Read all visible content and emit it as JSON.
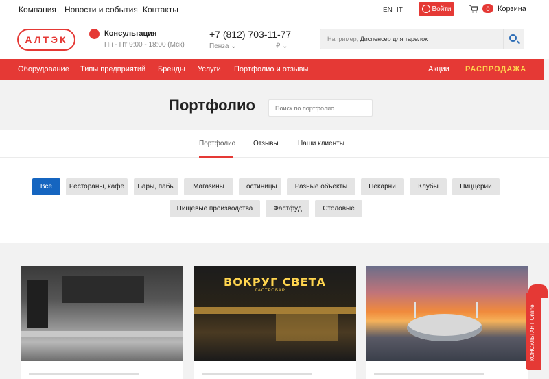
{
  "topbar": {
    "nav": [
      "Компания",
      "Новости и события",
      "Контакты"
    ],
    "langs": [
      "EN",
      "IT"
    ],
    "login": "Войти",
    "cart_count": "0",
    "cart_label": "Корзина"
  },
  "header": {
    "logo": "АЛТЭК",
    "consult_title": "Консультация",
    "consult_hours": "Пн - Пт 9:00 - 18:00 (Мск)",
    "phone": "+7 (812) 703-11-77",
    "city": "Пенза",
    "currency": "₽",
    "search_prefix": "Например,",
    "search_example": "Диспенсер для тарелок"
  },
  "rednav": {
    "items": [
      "Оборудование",
      "Типы предприятий",
      "Бренды",
      "Услуги",
      "Портфолио и отзывы"
    ],
    "promo": "Акции",
    "sale": "РАСПРОДАЖА"
  },
  "page": {
    "title": "Портфолио",
    "search_placeholder": "Поиск по портфолио"
  },
  "tabs": [
    "Портфолио",
    "Отзывы",
    "Наши клиенты"
  ],
  "filters": {
    "row1": [
      "Все",
      "Рестораны, кафе",
      "Бары, пабы",
      "Магазины",
      "Гостиницы",
      "Разные объекты",
      "Пекарни",
      "Клубы",
      "Пиццерии"
    ],
    "row2": [
      "Пищевые производства",
      "Фастфуд",
      "Столовые"
    ]
  },
  "cards": {
    "sign": "ВОКРУГ СВЕТА",
    "sign_sub": "ГАСТРОБАР"
  },
  "consultant": "КОНСУЛЬТАНТ Online",
  "colors": {
    "accent": "#e53935",
    "active_filter": "#1565c0",
    "sale": "#ffd54f"
  }
}
